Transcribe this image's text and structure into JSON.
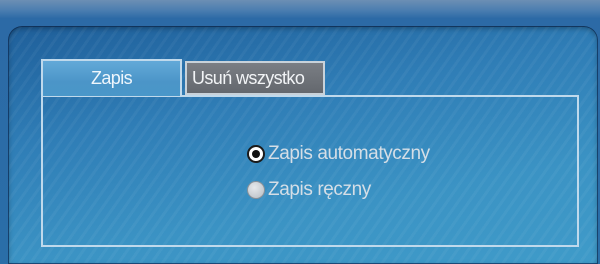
{
  "tabs": [
    {
      "label": "Zapis",
      "active": true
    },
    {
      "label": "Usuń wszystko",
      "active": false
    }
  ],
  "options": [
    {
      "label": "Zapis automatyczny",
      "selected": true
    },
    {
      "label": "Zapis ręczny",
      "selected": false
    }
  ],
  "colors": {
    "panel_blue": "#2f7db6",
    "active_tab": "#4b95c8",
    "inactive_tab": "#6a6e74",
    "border": "#bfd9ec",
    "text": "#d5dee6"
  }
}
